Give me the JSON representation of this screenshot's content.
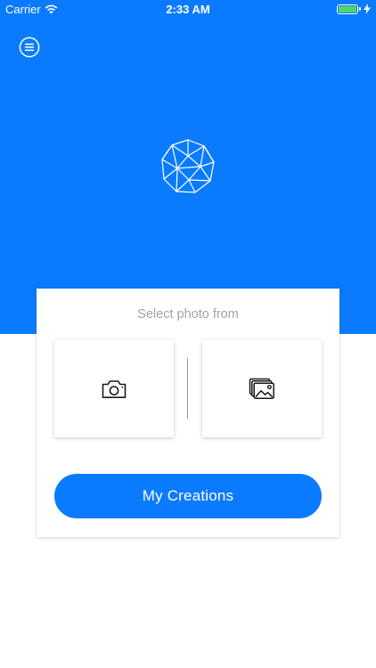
{
  "status_bar": {
    "carrier": "Carrier",
    "time": "2:33 AM",
    "battery_level": 1.0
  },
  "colors": {
    "brand_blue": "#0a7bff",
    "battery_green": "#4cd964",
    "muted_text": "#a3a3a3"
  },
  "header": {
    "menu_icon": "hamburger-circle-icon",
    "logo_icon": "geometric-diamond-icon"
  },
  "card": {
    "title": "Select photo from",
    "sources": [
      {
        "icon": "camera-icon"
      },
      {
        "icon": "photo-gallery-icon"
      }
    ],
    "primary_button_label": "My Creations"
  }
}
